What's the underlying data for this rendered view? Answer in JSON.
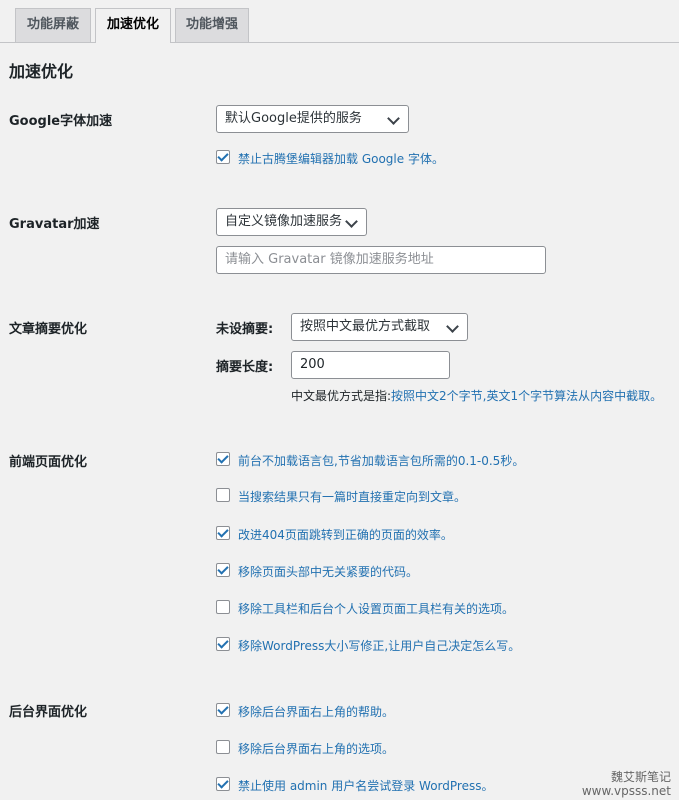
{
  "tabs": [
    "功能屏蔽",
    "加速优化",
    "功能增强"
  ],
  "page_title": "加速优化",
  "google": {
    "label": "Google字体加速",
    "select_value": "默认Google提供的服务",
    "checkbox_label": "禁止古腾堡编辑器加载 Google 字体。"
  },
  "gravatar": {
    "label": "Gravatar加速",
    "select_value": "自定义镜像加速服务",
    "input_placeholder": "请输入 Gravatar 镜像加速服务地址"
  },
  "excerpt": {
    "label": "文章摘要优化",
    "no_excerpt_label": "未设摘要:",
    "no_excerpt_value": "按照中文最优方式截取",
    "length_label": "摘要长度:",
    "length_value": "200",
    "note_prefix": "中文最优方式是指:",
    "note_rest": "按照中文2个字节,英文1个字节算法从内容中截取。"
  },
  "frontend": {
    "label": "前端页面优化",
    "options": [
      {
        "label": "前台不加载语言包,节省加载语言包所需的0.1-0.5秒。",
        "checked": true
      },
      {
        "label": "当搜索结果只有一篇时直接重定向到文章。",
        "checked": false
      },
      {
        "label": "改进404页面跳转到正确的页面的效率。",
        "checked": true
      },
      {
        "label": "移除页面头部中无关紧要的代码。",
        "checked": true
      },
      {
        "label": "移除工具栏和后台个人设置页面工具栏有关的选项。",
        "checked": false
      },
      {
        "label": "移除WordPress大小写修正,让用户自己决定怎么写。",
        "checked": true
      }
    ]
  },
  "backend": {
    "label": "后台界面优化",
    "options": [
      {
        "label": "移除后台界面右上角的帮助。",
        "checked": true
      },
      {
        "label": "移除后台界面右上角的选项。",
        "checked": false
      },
      {
        "label": "禁止使用 admin 用户名尝试登录 WordPress。",
        "checked": true
      }
    ]
  },
  "watermark": {
    "line1": "魏艾斯笔记",
    "line2": "www.vpsss.net"
  }
}
